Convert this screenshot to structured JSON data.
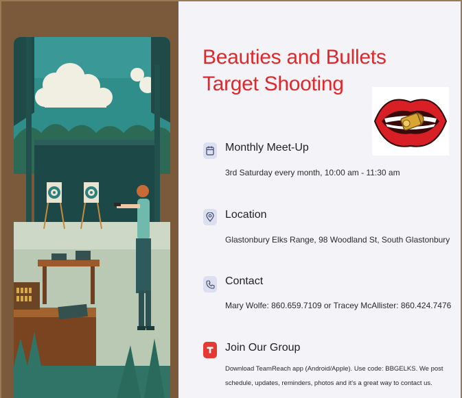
{
  "title": {
    "line1": "Beauties and Bullets",
    "line2": "Target Shooting"
  },
  "sections": [
    {
      "icon": "calendar-icon",
      "title": "Monthly Meet-Up",
      "text": "3rd Saturday every month, 10:00 am - 11:30 am"
    },
    {
      "icon": "location-pin-icon",
      "title": "Location",
      "text": "Glastonbury Elks Range, 98 Woodland St, South Glastonbury"
    },
    {
      "icon": "phone-icon",
      "title": "Contact",
      "text": "Mary Wolfe: 860.659.7109 or Tracey McAllister: 860.424.7476"
    },
    {
      "icon": "teamreach-app-icon",
      "title": "Join Our Group",
      "text_line1": "Download TeamReach app (Android/Apple). Use code: BBGELKS. We post",
      "text_line2": "schedule, updates, reminders, photos and it's a great way to contact us."
    }
  ],
  "colors": {
    "title": "#e0282b",
    "panel_bg": "#f3f3f8",
    "icon_bg": "#dcdff0",
    "icon_red": "#e53935",
    "frame": "#7b5a3c"
  }
}
